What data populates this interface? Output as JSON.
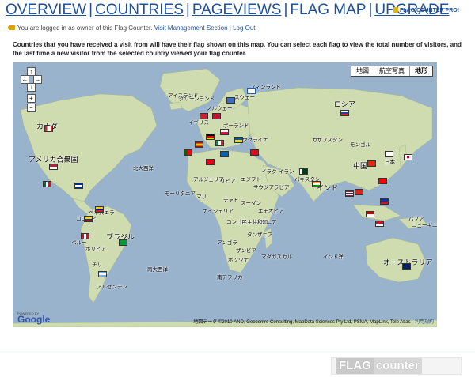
{
  "nav": {
    "overview": "OVERVIEW",
    "countries": "COUNTRIES",
    "pageviews": "PAGEVIEWS",
    "flagmap": "FLAG MAP",
    "upgrade": "UPGRADE",
    "sep": "|",
    "pro": "FLAG COUNTER PRO!"
  },
  "login": {
    "text": "You are logged in as owner of this Flag Counter.",
    "visit_link": "Visit Management Section",
    "sep": "|",
    "logout": "Log Out"
  },
  "description": "Countries that you have received a visit from will have their flag shown on this map. You can select each flag to view the total number of visitors, and the last time a new visitor from the selected country viewed your flag counter.",
  "map": {
    "types": [
      "地図",
      "航空写真",
      "地形"
    ],
    "selected_type": "地形",
    "zoom": {
      "up": "↑",
      "left": "←",
      "right": "→",
      "down": "↓",
      "plus": "+",
      "minus": "−"
    },
    "labels": {
      "greenland": "グリーンランド",
      "iceland": "アイスランド",
      "finland": "フィンランド",
      "sweden": "スウェー",
      "norway": "ノルウェー",
      "uk": "イギリス",
      "poland": "ポーランド",
      "ukraine": "ウクライナ",
      "russia": "ロシア",
      "kazakhstan": "カザフスタン",
      "mongolia": "モンゴル",
      "canada": "カナダ",
      "usa": "アメリカ合衆国",
      "china": "中国",
      "mexico": "メキシコ",
      "north_atlantic": "北大西洋",
      "algeria": "アルジェリア",
      "libya": "リビア",
      "egypt": "エジプト",
      "iraq": "イラク",
      "iran": "イラン",
      "pakistan": "パキスタン",
      "india": "インド",
      "saudi": "サウジアラビア",
      "mauritania": "モーリタニア",
      "mali": "マリ",
      "chad": "チャド",
      "sudan": "スーダン",
      "niger": "ナイジェリア",
      "ethiopia": "エチオピア",
      "venezuela": "ベネズエラ",
      "colombia": "コロンビ",
      "brazil": "ブラジル",
      "peru": "ペルー",
      "bolivia": "ボリビア",
      "chile": "チリ",
      "argentina": "アルゼンチン",
      "kenya": "ケニア",
      "congo": "コンゴ民主共和国",
      "tanzania": "タンザニア",
      "angola": "アンゴラ",
      "zambia": "ザンビア",
      "botswana": "ボツワナ",
      "madagascar": "マダガスカル",
      "south_africa": "南アフリカ",
      "south_atlantic": "南大西洋",
      "indian_ocean": "インド洋",
      "australia": "オーストラリア",
      "papua": "パプア",
      "new_guinea": "ニューギニ",
      "japan": "日本"
    },
    "powered_by": "POWERED BY",
    "google": "Google",
    "copyright": "地図データ ©2010 AND, Geocentre Consulting, MapData Sciences Pty Ltd, PSMA, MapLink, Tele Atlas -",
    "terms": "利用規約"
  },
  "footer": {
    "flag": "FLAG",
    "counter": "counter"
  },
  "colors": {
    "ocean": "#99b3cc",
    "land": "#cfdcb0",
    "link": "#1e4f97"
  }
}
